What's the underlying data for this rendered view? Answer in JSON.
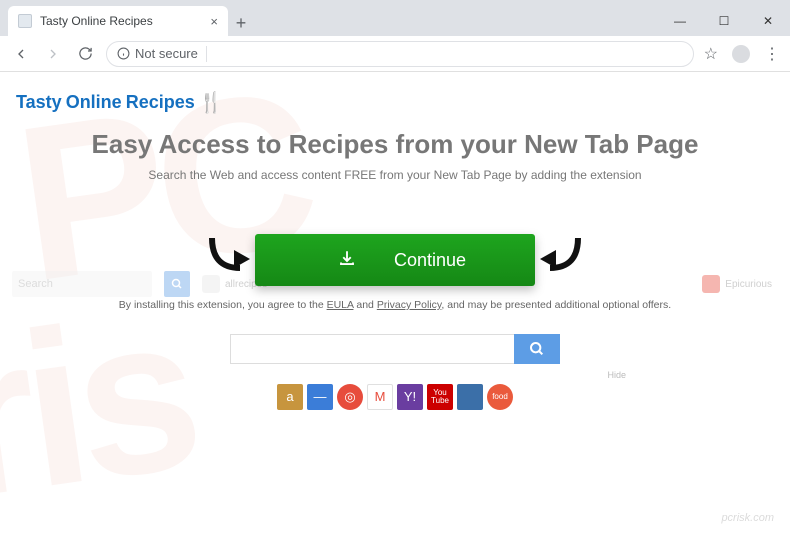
{
  "window": {
    "tab_title": "Tasty Online Recipes"
  },
  "addressbar": {
    "security": "Not secure",
    "url": ""
  },
  "logo": {
    "word1": "Tasty",
    "word2": "Online",
    "word3": "Recipes"
  },
  "hero": {
    "headline": "Easy Access to Recipes from your New Tab Page",
    "subhead": "Search the Web and access content FREE from your New Tab Page by adding the extension"
  },
  "bgtoolbar": {
    "search_placeholder": "Search",
    "link1": "allrecipes",
    "link2": "Epicurious"
  },
  "cta": {
    "label": "Continue"
  },
  "disclaimer": {
    "pre": "By installing this extension, you agree to the ",
    "eula": "EULA",
    "and": " and ",
    "privacy": "Privacy Policy",
    "post": ", and may be presented additional optional offers."
  },
  "centersearch": {
    "placeholder": ""
  },
  "quick": {
    "hide": "Hide"
  },
  "watermark": "pcrisk.com"
}
